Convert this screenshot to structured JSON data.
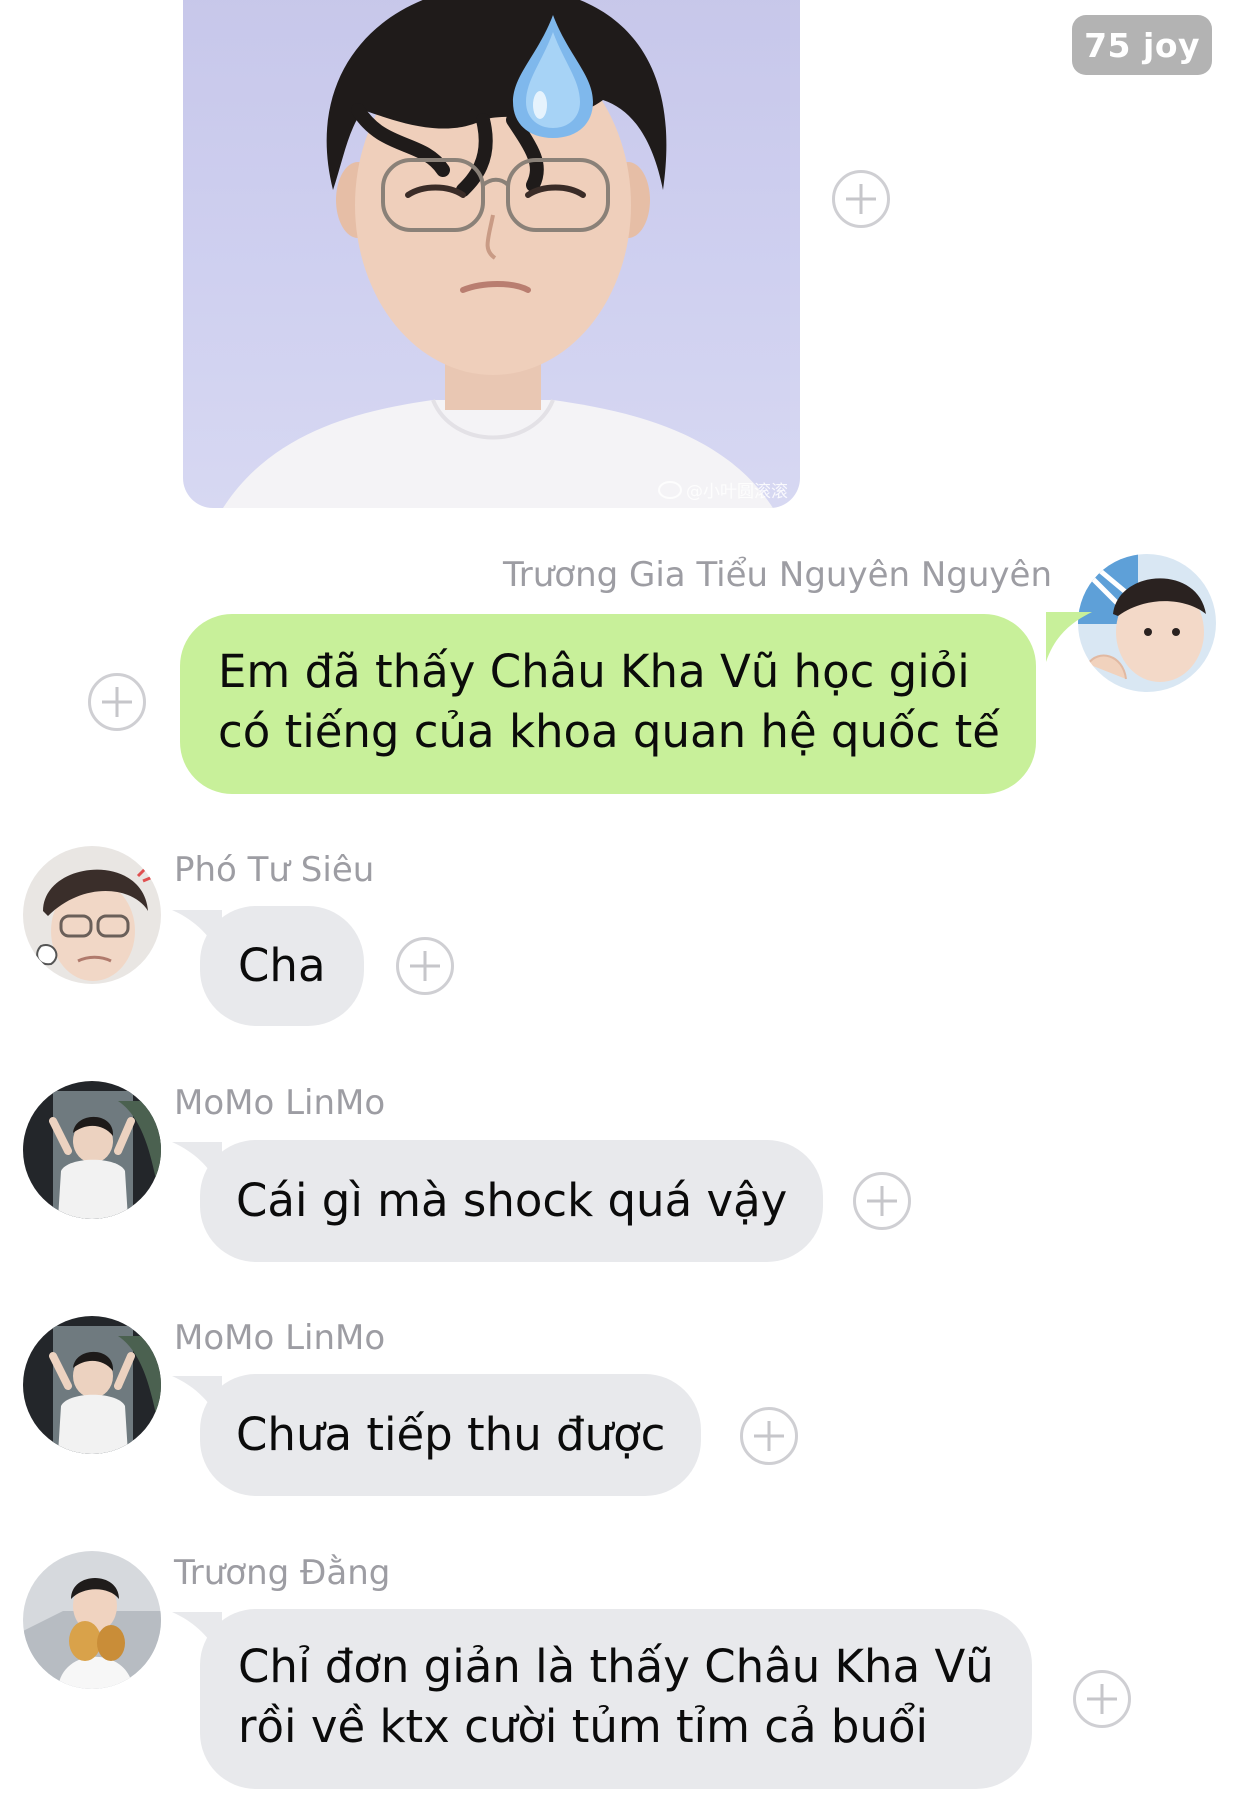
{
  "sticker": {
    "watermark": "@小叶圆滚滚"
  },
  "badge": {
    "text": "75 joy"
  },
  "messages": [
    {
      "sender": "Trương Gia Tiểu Nguyên Nguyên",
      "lines": [
        "Em đã thấy Châu Kha Vũ học giỏi",
        "có tiếng của khoa quan hệ quốc tế"
      ],
      "side": "right"
    },
    {
      "sender": "Phó Tư Siêu",
      "lines": [
        "Cha"
      ],
      "side": "left"
    },
    {
      "sender": "MoMo LinMo",
      "lines": [
        "Cái gì mà shock quá vậy"
      ],
      "side": "left"
    },
    {
      "sender": "MoMo LinMo",
      "lines": [
        "Chưa tiếp thu được"
      ],
      "side": "left"
    },
    {
      "sender": "Trương Đằng",
      "lines": [
        "Chỉ đơn giản là thấy Châu Kha Vũ",
        "rồi về ktx cười tủm tỉm cả buổi"
      ],
      "side": "left"
    }
  ],
  "colors": {
    "outgoing_bubble": "#c8f09a",
    "incoming_bubble": "#e8e9ec",
    "sender_name": "#9d9da3",
    "badge_bg": "#b3b3b3"
  },
  "icons": {
    "add_reaction": "plus-circle-icon",
    "sweat_drop": "sweat-drop-icon"
  }
}
